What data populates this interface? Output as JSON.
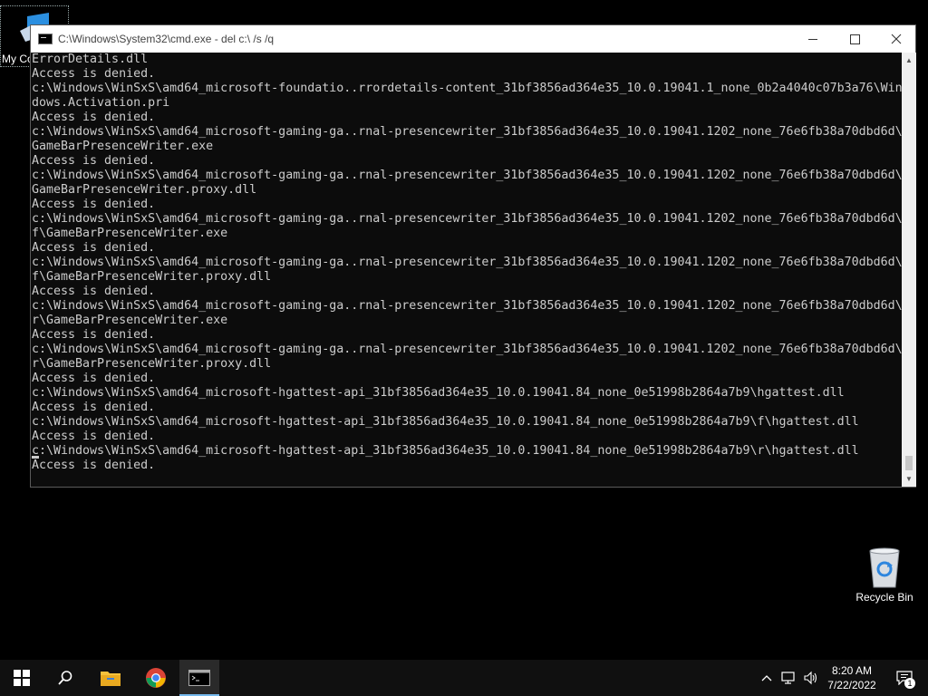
{
  "desktop": {
    "icons": [
      {
        "label": "My Co"
      },
      {
        "label": "Recycle Bin"
      }
    ]
  },
  "window": {
    "title": "C:\\Windows\\System32\\cmd.exe - del  c:\\ /s /q",
    "console_lines": [
      "ErrorDetails.dll",
      "Access is denied.",
      "c:\\Windows\\WinSxS\\amd64_microsoft-foundatio..rrordetails-content_31bf3856ad364e35_10.0.19041.1_none_0b2a4040c07b3a76\\Win",
      "dows.Activation.pri",
      "Access is denied.",
      "c:\\Windows\\WinSxS\\amd64_microsoft-gaming-ga..rnal-presencewriter_31bf3856ad364e35_10.0.19041.1202_none_76e6fb38a70dbd6d\\",
      "GameBarPresenceWriter.exe",
      "Access is denied.",
      "c:\\Windows\\WinSxS\\amd64_microsoft-gaming-ga..rnal-presencewriter_31bf3856ad364e35_10.0.19041.1202_none_76e6fb38a70dbd6d\\",
      "GameBarPresenceWriter.proxy.dll",
      "Access is denied.",
      "c:\\Windows\\WinSxS\\amd64_microsoft-gaming-ga..rnal-presencewriter_31bf3856ad364e35_10.0.19041.1202_none_76e6fb38a70dbd6d\\",
      "f\\GameBarPresenceWriter.exe",
      "Access is denied.",
      "c:\\Windows\\WinSxS\\amd64_microsoft-gaming-ga..rnal-presencewriter_31bf3856ad364e35_10.0.19041.1202_none_76e6fb38a70dbd6d\\",
      "f\\GameBarPresenceWriter.proxy.dll",
      "Access is denied.",
      "c:\\Windows\\WinSxS\\amd64_microsoft-gaming-ga..rnal-presencewriter_31bf3856ad364e35_10.0.19041.1202_none_76e6fb38a70dbd6d\\",
      "r\\GameBarPresenceWriter.exe",
      "Access is denied.",
      "c:\\Windows\\WinSxS\\amd64_microsoft-gaming-ga..rnal-presencewriter_31bf3856ad364e35_10.0.19041.1202_none_76e6fb38a70dbd6d\\",
      "r\\GameBarPresenceWriter.proxy.dll",
      "Access is denied.",
      "c:\\Windows\\WinSxS\\amd64_microsoft-hgattest-api_31bf3856ad364e35_10.0.19041.84_none_0e51998b2864a7b9\\hgattest.dll",
      "Access is denied.",
      "c:\\Windows\\WinSxS\\amd64_microsoft-hgattest-api_31bf3856ad364e35_10.0.19041.84_none_0e51998b2864a7b9\\f\\hgattest.dll",
      "Access is denied.",
      "c:\\Windows\\WinSxS\\amd64_microsoft-hgattest-api_31bf3856ad364e35_10.0.19041.84_none_0e51998b2864a7b9\\r\\hgattest.dll",
      "Access is denied."
    ],
    "controls": {
      "minimize": "minimize-icon",
      "maximize": "maximize-icon",
      "close": "close-icon"
    }
  },
  "taskbar": {
    "items": [
      "start-icon",
      "search-icon",
      "file-explorer-icon",
      "chrome-icon",
      "command-prompt-icon"
    ],
    "clock": {
      "time": "8:20 AM",
      "date": "7/22/2022"
    },
    "notification_count": "1"
  },
  "colors": {
    "console_bg": "#0c0c0c",
    "console_fg": "#cccccc",
    "taskbar_bg": "#101010",
    "accent": "#76b9ed"
  }
}
